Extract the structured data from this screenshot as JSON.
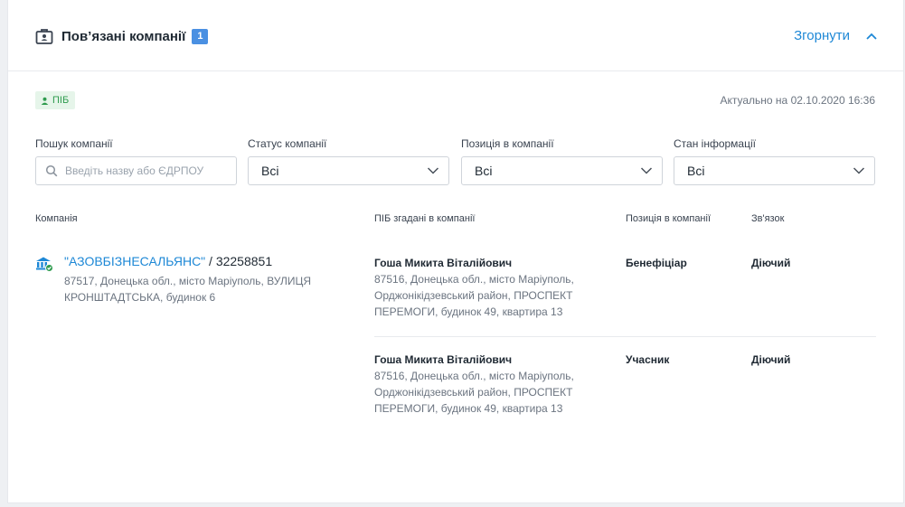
{
  "header": {
    "title": "Пов’язані компанії",
    "count": "1",
    "collapse_label": "Згорнути"
  },
  "badge": {
    "label": "ПІБ"
  },
  "updated": "Актуально на 02.10.2020 16:36",
  "filters": {
    "search": {
      "label": "Пошук компанії",
      "placeholder": "Введіть назву або ЄДРПОУ"
    },
    "status": {
      "label": "Статус компанії",
      "value": "Всі"
    },
    "position": {
      "label": "Позиція в компанії",
      "value": "Всі"
    },
    "info": {
      "label": "Стан інформації",
      "value": "Всі"
    }
  },
  "table": {
    "headers": {
      "company": "Компанія",
      "person": "ПІБ згадані в компанії",
      "position": "Позиція в компанії",
      "relation": "Зв'язок"
    },
    "company": {
      "name": "\"АЗОВБІЗНЕСАЛЬЯНС\"",
      "code": " / 32258851",
      "address": "87517, Донецька обл., місто Маріуполь, ВУЛИЦЯ КРОНШТАДТСЬКА, будинок 6"
    },
    "rows": [
      {
        "name": "Гоша Микита Віталійович",
        "address": "87516, Донецька обл., місто Маріуполь, Орджонікідзевський район, ПРОСПЕКТ ПЕРЕМОГИ, будинок 49, квартира 13",
        "position": "Бенефіціар",
        "relation": "Діючий"
      },
      {
        "name": "Гоша Микита Віталійович",
        "address": "87516, Донецька обл., місто Маріуполь, Орджонікідзевський район, ПРОСПЕКТ ПЕРЕМОГИ, будинок 49, квартира 13",
        "position": "Учасник",
        "relation": "Діючий"
      }
    ]
  },
  "colors": {
    "accent": "#1e88d6",
    "count_badge": "#4a90e2",
    "pib_badge_bg": "#e6f5ea",
    "pib_badge_text": "#2e9b4e",
    "company_icon": "#1e88d6",
    "company_icon_check": "#2e9b4e"
  },
  "icons": {
    "header": "briefcase-icon",
    "collapse": "chevron-up-icon",
    "badge": "person-icon",
    "search": "search-icon",
    "select": "chevron-down-icon",
    "company": "bank-building-icon"
  }
}
